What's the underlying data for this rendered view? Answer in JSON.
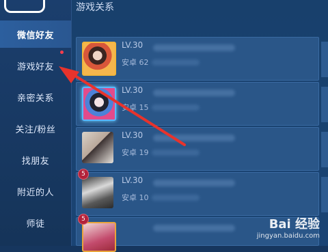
{
  "header": {
    "title": "游戏关系"
  },
  "sidebar": {
    "items": [
      {
        "label": "微信好友",
        "active": true
      },
      {
        "label": "游戏好友",
        "active": false
      },
      {
        "label": "亲密关系",
        "active": false
      },
      {
        "label": "关注/粉丝",
        "active": false
      },
      {
        "label": "找朋友",
        "active": false
      },
      {
        "label": "附近的人",
        "active": false
      },
      {
        "label": "师徒",
        "active": false
      }
    ]
  },
  "friends": [
    {
      "level": "LV.30",
      "platform": "安卓 62"
    },
    {
      "level": "LV.30",
      "platform": "安卓 15"
    },
    {
      "level": "LV.30",
      "platform": "安卓 19"
    },
    {
      "level": "LV.30",
      "platform": "安卓 10",
      "badge": "5"
    },
    {
      "badge": "5"
    }
  ],
  "watermark": {
    "brand": "Bai 经验",
    "url": "jingyan.baidu.com"
  },
  "colors": {
    "accent_arrow": "#e8332c",
    "sidebar_active": "#2c5f9e",
    "notify_dot": "#ff3d4c"
  }
}
